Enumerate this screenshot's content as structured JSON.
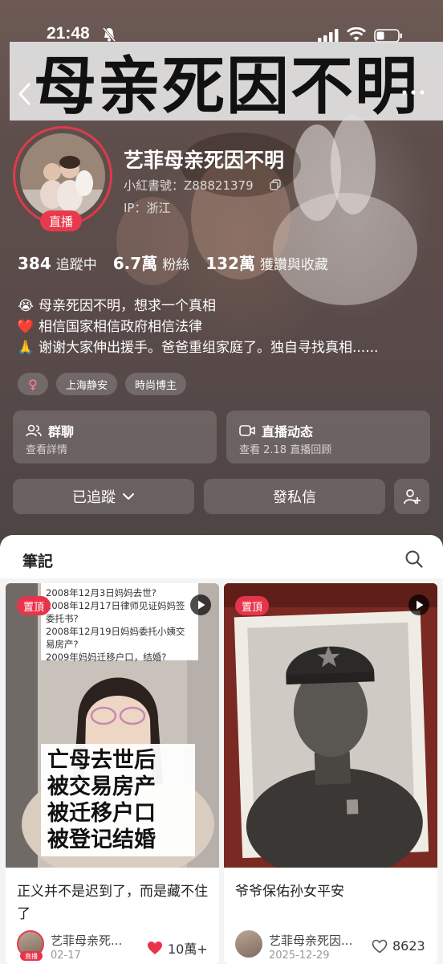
{
  "status_bar": {
    "time": "21:48"
  },
  "banner": {
    "headline": "母亲死因不明"
  },
  "profile": {
    "name": "艺菲母亲死因不明",
    "id_line": "小紅書號：Z88821379",
    "ip_line": "IP：浙江",
    "live_badge": "直播"
  },
  "stats": [
    {
      "num": "384",
      "label": "追蹤中"
    },
    {
      "num": "6.7萬",
      "label": "粉絲"
    },
    {
      "num": "132萬",
      "label": "獲讚與收藏"
    }
  ],
  "bio": [
    {
      "emoji": "😭",
      "text": "母亲死因不明，想求一个真相"
    },
    {
      "emoji": "❤️",
      "text": "相信国家相信政府相信法律"
    },
    {
      "emoji": "🙏",
      "text": "谢谢大家伸出援手。爸爸重组家庭了。独自寻找真相......"
    }
  ],
  "tags": {
    "gender": "♀",
    "items": [
      "上海静安",
      "時尚博主"
    ]
  },
  "cards": [
    {
      "title": "群聊",
      "sub": "查看詳情"
    },
    {
      "title": "直播动态",
      "sub": "查看 2.18 直播回顾"
    }
  ],
  "buttons": {
    "follow": "已追蹤",
    "message": "發私信"
  },
  "notes": {
    "tab": "筆記",
    "items": [
      {
        "pin": "置頂",
        "memo": [
          "2008年12月3日妈妈去世?",
          "2008年12月17日律师见证妈妈签委托书?",
          "2008年12月19日妈妈委托小姨交易房产?",
          "2009年妈妈迁移户口，结婚?"
        ],
        "overlay": [
          "亡母去世后",
          "被交易房产",
          "被迁移户口",
          "被登记结婚"
        ],
        "title": "正义并不是迟到了，而是藏不住了",
        "author": "艺菲母亲死...",
        "date": "02-17",
        "likes": "10萬+",
        "liked": true,
        "author_badge": "直播"
      },
      {
        "pin": "置頂",
        "title": "爷爷保佑孙女平安",
        "author": "艺菲母亲死因...",
        "date": "2025-12-29",
        "likes": "8623",
        "liked": false
      }
    ]
  },
  "colors": {
    "accent": "#e8344a",
    "panel": "#ffffff"
  }
}
